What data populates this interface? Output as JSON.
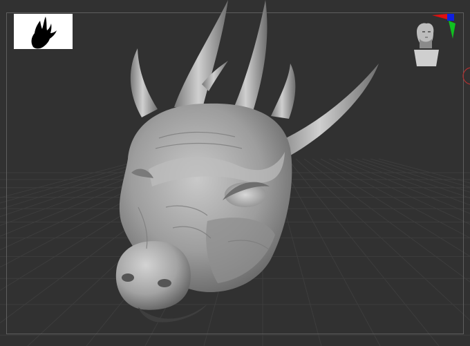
{
  "app": {
    "view": "3d-viewport"
  },
  "thumbnail": {
    "icon": "silhouette-preview-icon",
    "background": "#ffffff",
    "fill": "#000000"
  },
  "navigation": {
    "widget": "head-navigation-gizmo",
    "axes": [
      {
        "name": "x-axis",
        "color": "#e01010"
      },
      {
        "name": "y-axis",
        "color": "#10c020"
      },
      {
        "name": "z-axis",
        "color": "#1020e0"
      }
    ]
  },
  "scene": {
    "model": "dragon-head-sculpt",
    "material_color": "#9a9a9a",
    "background_color": "#313131",
    "floor_grid": true
  }
}
